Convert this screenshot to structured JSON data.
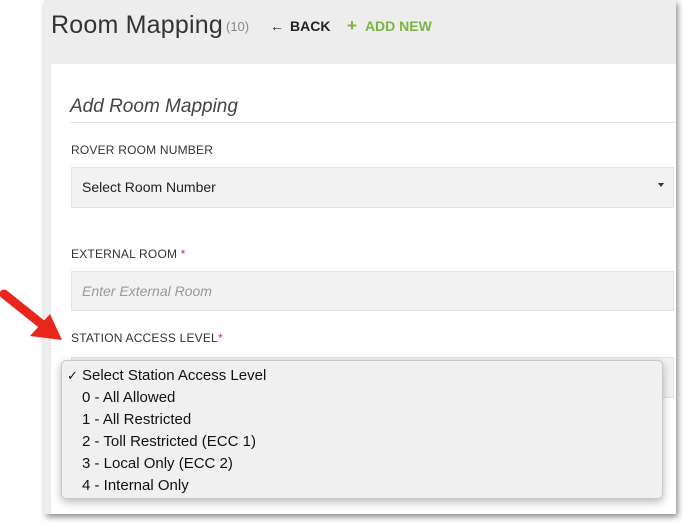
{
  "header": {
    "title": "Room Mapping",
    "count": "(10)",
    "back_label": "BACK",
    "add_new_label": "ADD NEW"
  },
  "form": {
    "heading": "Add Room Mapping",
    "rover_room": {
      "label": "ROVER ROOM NUMBER",
      "value": "Select Room Number"
    },
    "external_room": {
      "label": "EXTERNAL ROOM",
      "required_mark": "*",
      "placeholder": "Enter External Room"
    },
    "station_access": {
      "label": "STATION ACCESS LEVEL",
      "required_mark": "*",
      "options": [
        "Select Station Access Level",
        "0 - All Allowed",
        "1 - All Restricted",
        "2 - Toll Restricted (ECC 1)",
        "3 - Local Only (ECC 2)",
        "4 - Internal Only"
      ],
      "selected_index": 0,
      "check_mark": "✓"
    }
  },
  "colors": {
    "accent_green": "#7cb342",
    "required_red": "#d9342b",
    "arrow_red": "#e8261c"
  },
  "icons": {
    "back": "left-arrow-icon",
    "add": "plus-icon",
    "caret": "caret-down-icon",
    "check": "checkmark-icon"
  }
}
